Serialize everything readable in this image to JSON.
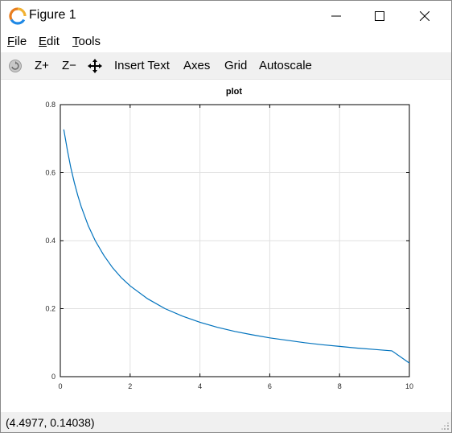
{
  "window": {
    "title": "Figure 1",
    "icon": "octave-icon"
  },
  "menu": {
    "items": [
      {
        "prefix": "",
        "accel": "F",
        "rest": "ile"
      },
      {
        "prefix": "",
        "accel": "E",
        "rest": "dit"
      },
      {
        "prefix": "",
        "accel": "T",
        "rest": "ools"
      }
    ]
  },
  "toolbar": {
    "rotate_icon": "rotate-icon",
    "zoom_in": "Z+",
    "zoom_out": "Z−",
    "pan_icon": "pan-icon",
    "insert_text": "Insert Text",
    "axes": "Axes",
    "grid": "Grid",
    "autoscale": "Autoscale"
  },
  "status": {
    "coords": "(4.4977, 0.14038)"
  },
  "chart_data": {
    "type": "line",
    "title": "plot",
    "xlabel": "",
    "ylabel": "",
    "xlim": [
      0,
      10
    ],
    "ylim": [
      0,
      0.8
    ],
    "xticks": [
      0,
      2,
      4,
      6,
      8,
      10
    ],
    "yticks": [
      0,
      0.2,
      0.4,
      0.6,
      0.8
    ],
    "xtick_labels": [
      "0",
      "2",
      "4",
      "6",
      "8",
      "10"
    ],
    "ytick_labels": [
      "0",
      "0.2",
      "0.4",
      "0.6",
      "0.8"
    ],
    "grid": true,
    "line_color": "#0072bd",
    "series": [
      {
        "x": [
          0.1,
          0.2,
          0.3,
          0.4,
          0.5,
          0.6,
          0.8,
          1.0,
          1.25,
          1.5,
          1.75,
          2.0,
          2.5,
          3.0,
          3.5,
          4.0,
          4.5,
          5.0,
          5.5,
          6.0,
          6.5,
          7.0,
          7.5,
          8.0,
          8.5,
          9.0,
          9.5,
          10.0
        ],
        "y": [
          0.727,
          0.667,
          0.615,
          0.571,
          0.533,
          0.5,
          0.444,
          0.4,
          0.356,
          0.32,
          0.291,
          0.267,
          0.229,
          0.2,
          0.178,
          0.16,
          0.145,
          0.133,
          0.123,
          0.114,
          0.107,
          0.1,
          0.094,
          0.089,
          0.084,
          0.08,
          0.076,
          0.04
        ]
      }
    ]
  }
}
